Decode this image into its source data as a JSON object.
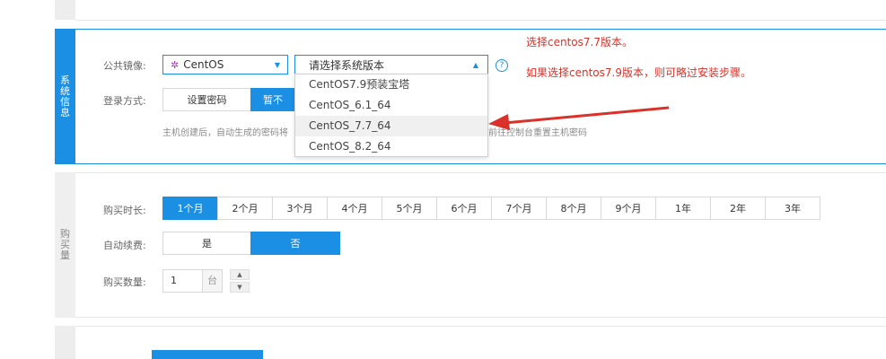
{
  "system_section": {
    "side_label": "系统信息",
    "image_label": "公共镜像:",
    "image_select_value": "CentOS",
    "version_select_placeholder": "请选择系统版本",
    "login_label": "登录方式:",
    "login_options": [
      "设置密码",
      "暂不"
    ],
    "hint": "主机创建后，自动生成的密码将",
    "hint_tail": "前往控制台重置主机密码",
    "dropdown_options": [
      "CentOS7.9预装宝塔",
      "CentOS_6.1_64",
      "CentOS_7.7_64",
      "CentOS_8.2_64"
    ],
    "help_symbol": "?"
  },
  "annotations": {
    "line1": "选择centos7.7版本。",
    "line2": "如果选择centos7.9版本，则可略过安装步骤。"
  },
  "purchase_section": {
    "side_label": "购买量",
    "duration_label": "购买时长:",
    "durations": [
      "1个月",
      "2个月",
      "3个月",
      "4个月",
      "5个月",
      "6个月",
      "7个月",
      "8个月",
      "9个月",
      "1年",
      "2年",
      "3年"
    ],
    "auto_renew_label": "自动续费:",
    "auto_renew_options": [
      "是",
      "否"
    ],
    "quantity_label": "购买数量:",
    "quantity_value": "1",
    "quantity_unit": "台"
  },
  "colors": {
    "accent": "#1a8fe3",
    "annotation": "#d9322a"
  }
}
